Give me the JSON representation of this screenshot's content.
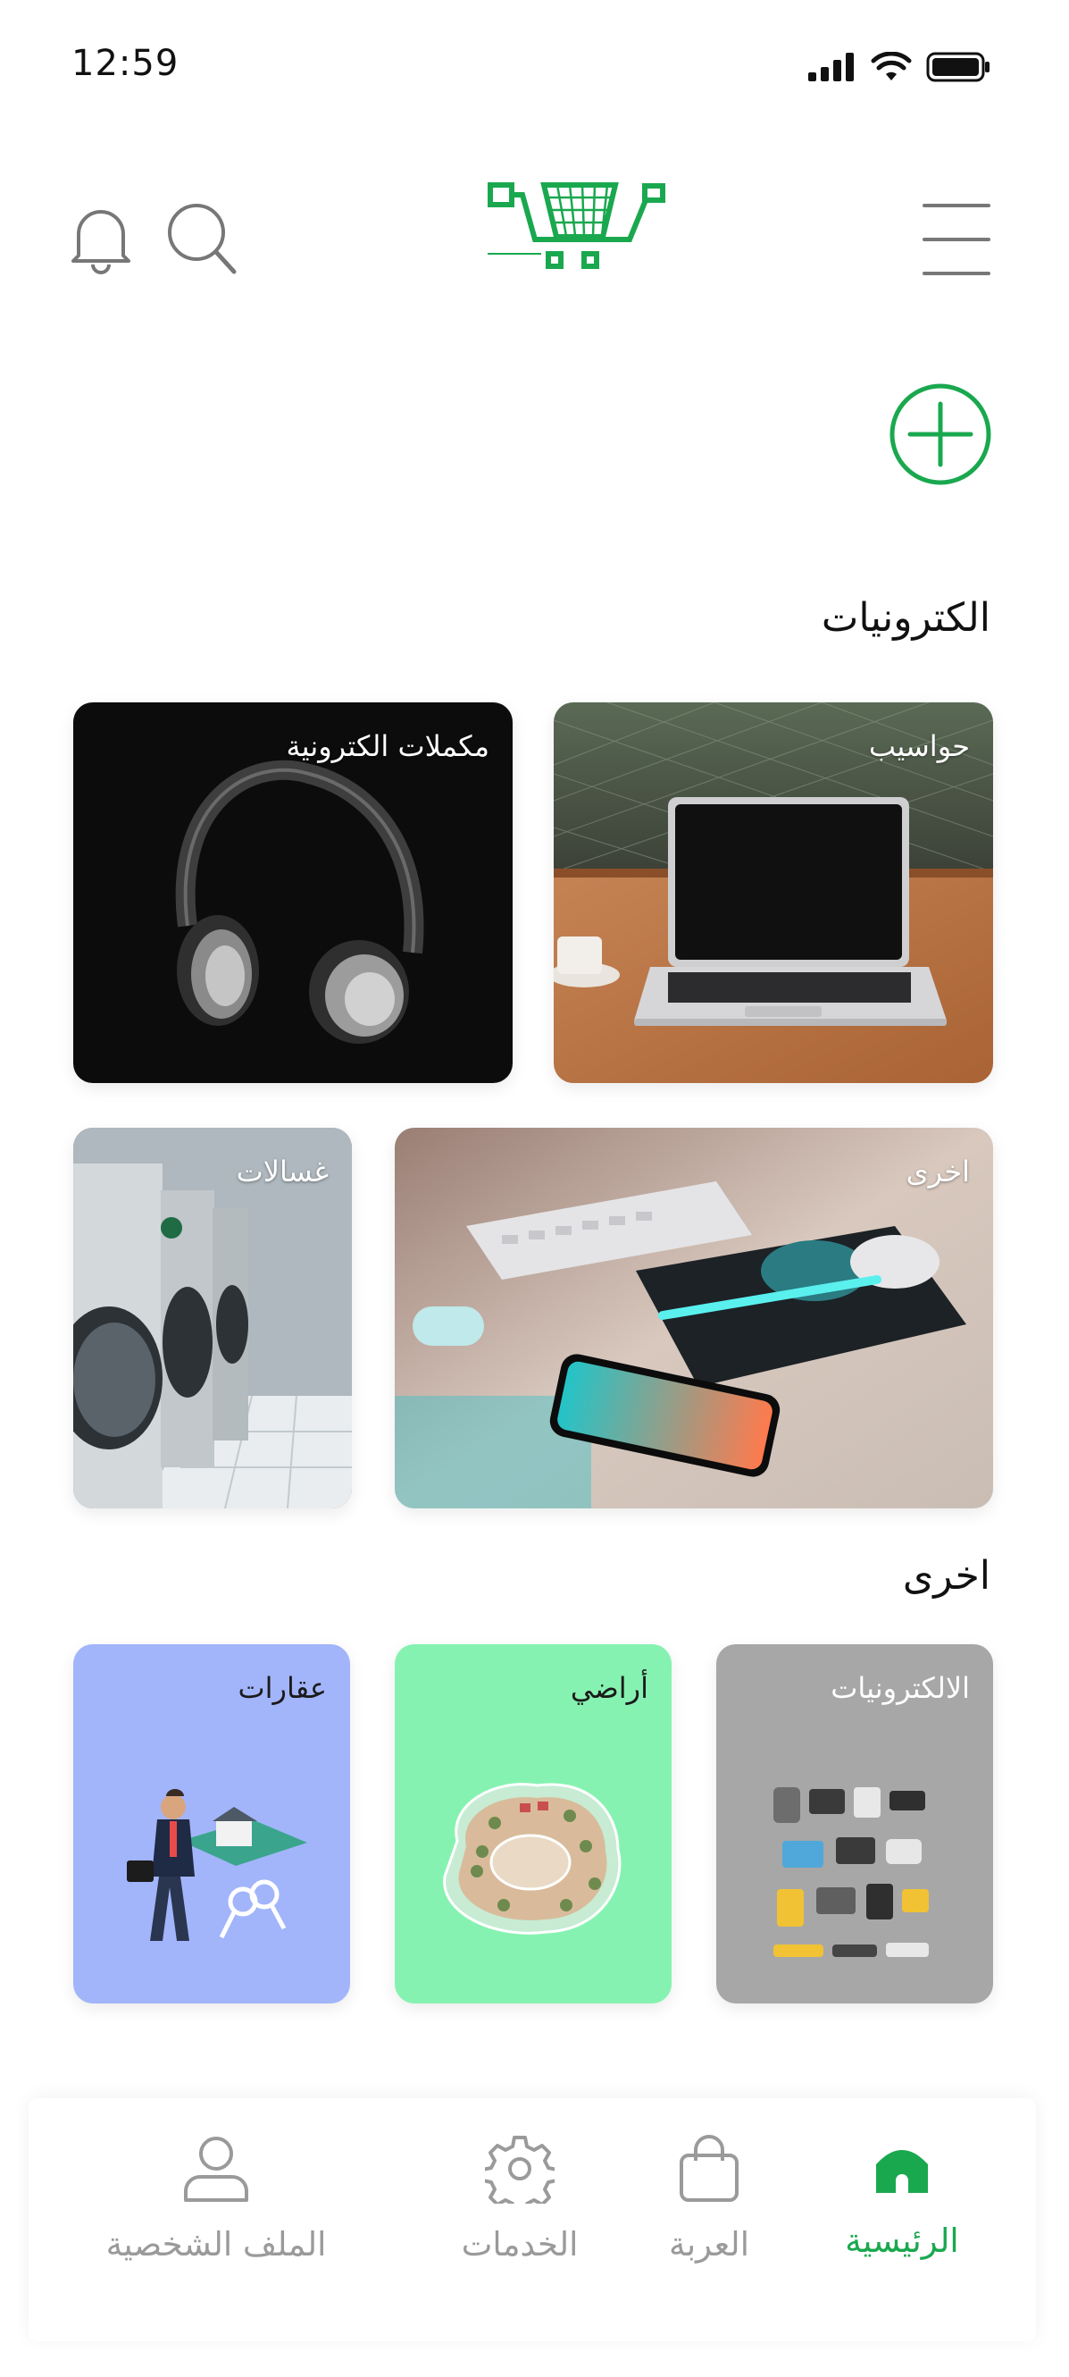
{
  "status_bar": {
    "time": "12:59"
  },
  "header": {
    "menu_icon": "hamburger-icon",
    "logo_icon": "cart-logo",
    "search_icon": "search-icon",
    "notification_icon": "bell-icon"
  },
  "add_button_icon": "plus-circle-icon",
  "sections": [
    {
      "title": "الكترونيات",
      "cards": [
        {
          "label": "حواسيب"
        },
        {
          "label": "مكملات الكترونية"
        },
        {
          "label": "اخرى"
        },
        {
          "label": "غسالات"
        }
      ]
    },
    {
      "title": "اخرى",
      "cards": [
        {
          "label": "الالكترونيات"
        },
        {
          "label": "أراضي"
        },
        {
          "label": "عقارات"
        }
      ]
    }
  ],
  "bottom_nav": [
    {
      "label": "الرئيسية",
      "icon": "home-icon",
      "active": true
    },
    {
      "label": "العربة",
      "icon": "shopping-bag-icon",
      "active": false
    },
    {
      "label": "الخدمات",
      "icon": "gear-icon",
      "active": false
    },
    {
      "label": "الملف الشخصية",
      "icon": "user-icon",
      "active": false
    }
  ],
  "colors": {
    "accent": "#1aa84f",
    "inactive": "#9a9a9a",
    "card_gray": "#a7a7a7",
    "card_green": "#86f2b1",
    "card_blue": "#a2b5fa"
  }
}
